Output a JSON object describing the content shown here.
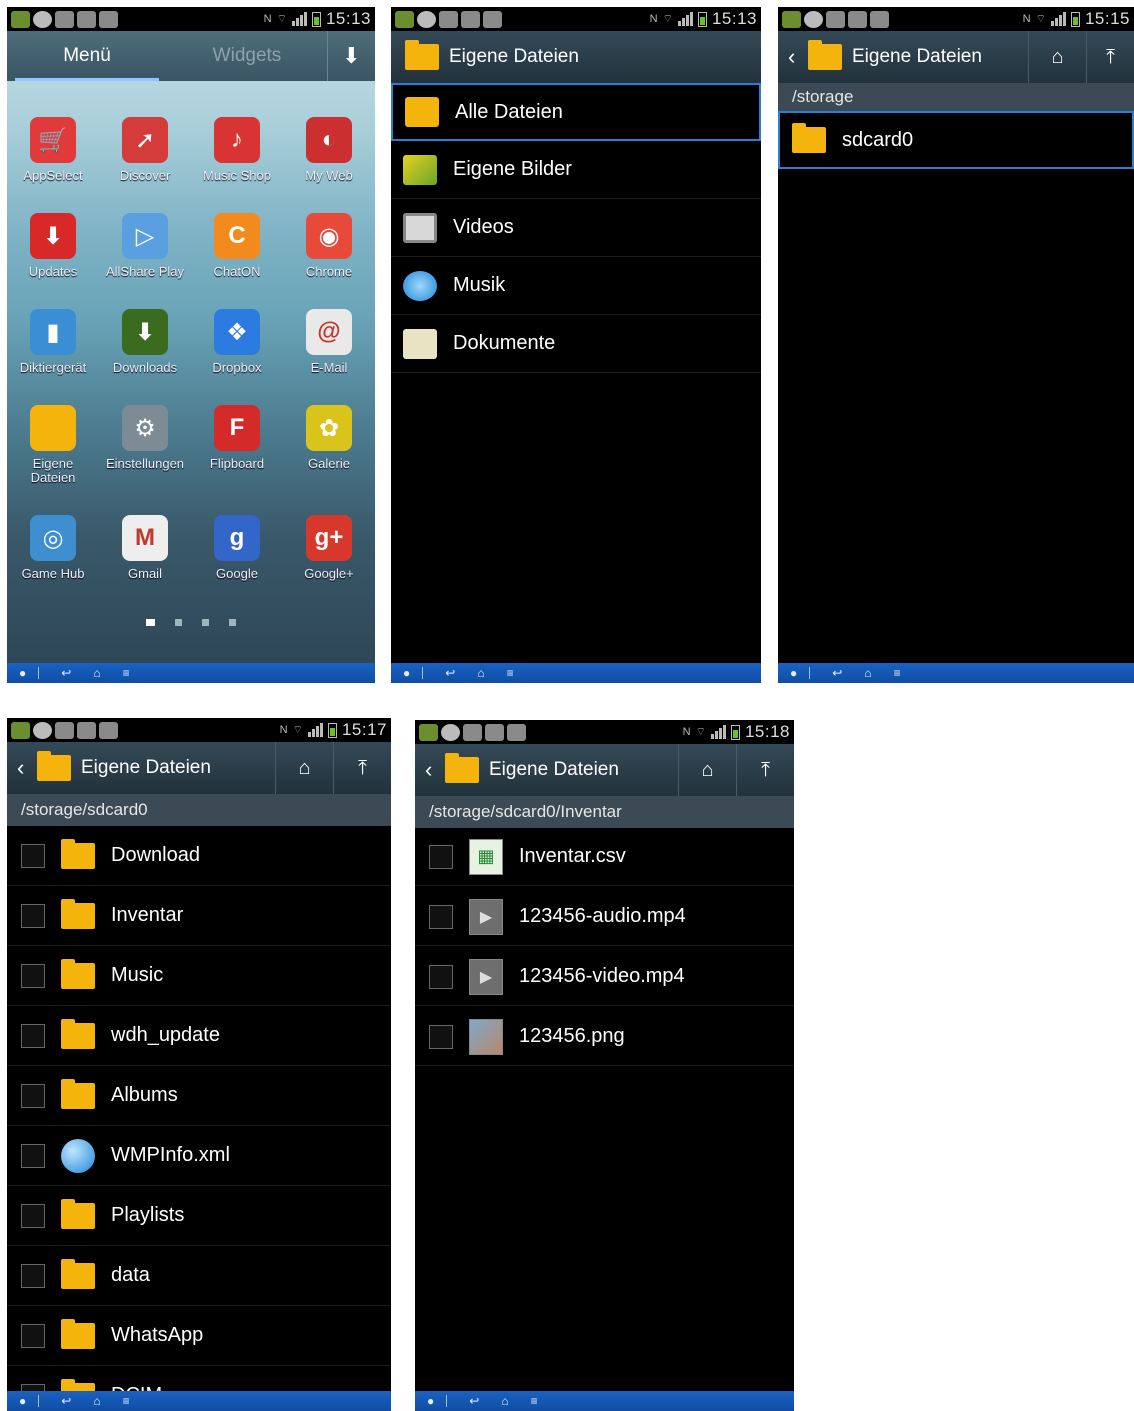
{
  "status": {
    "p1_clock": "15:13",
    "p2_clock": "15:13",
    "p3_clock": "15:15",
    "p4_clock": "15:17",
    "p5_clock": "15:18"
  },
  "home": {
    "tab_menu": "Menü",
    "tab_widgets": "Widgets",
    "apps": [
      {
        "label": "AppSelect",
        "color": "#e03a3a",
        "glyph": "🛒"
      },
      {
        "label": "Discover",
        "color": "#d43b3b",
        "glyph": "➚"
      },
      {
        "label": "Music Shop",
        "color": "#d93434",
        "glyph": "♪"
      },
      {
        "label": "My Web",
        "color": "#cc2f2f",
        "glyph": "◐"
      },
      {
        "label": "Updates",
        "color": "#d82828",
        "glyph": "⬇"
      },
      {
        "label": "AllShare Play",
        "color": "#5aa0e0",
        "glyph": "▷"
      },
      {
        "label": "ChatON",
        "color": "#f28a1e",
        "glyph": "C"
      },
      {
        "label": "Chrome",
        "color": "#e84a3a",
        "glyph": "◉"
      },
      {
        "label": "Diktiergerät",
        "color": "#3a8fd4",
        "glyph": "▮"
      },
      {
        "label": "Downloads",
        "color": "#3a6b1e",
        "glyph": "⬇"
      },
      {
        "label": "Dropbox",
        "color": "#2b7be0",
        "glyph": "❖"
      },
      {
        "label": "E-Mail",
        "color": "#e9e9e9",
        "glyph": "@"
      },
      {
        "label": "Eigene Dateien",
        "color": "#f5b40c",
        "glyph": ""
      },
      {
        "label": "Einstellungen",
        "color": "#7d8b95",
        "glyph": "⚙"
      },
      {
        "label": "Flipboard",
        "color": "#d42a2a",
        "glyph": "F"
      },
      {
        "label": "Galerie",
        "color": "#d9c41c",
        "glyph": "✿"
      },
      {
        "label": "Game Hub",
        "color": "#3d8fd0",
        "glyph": "◎"
      },
      {
        "label": "Gmail",
        "color": "#eeeeee",
        "glyph": "M"
      },
      {
        "label": "Google",
        "color": "#3465c8",
        "glyph": "g"
      },
      {
        "label": "Google+",
        "color": "#d6392b",
        "glyph": "g+"
      }
    ]
  },
  "fm": {
    "title": "Eigene Dateien",
    "categories": [
      "Alle Dateien",
      "Eigene Bilder",
      "Videos",
      "Musik",
      "Dokumente"
    ],
    "path_storage": "/storage",
    "storage_items": [
      "sdcard0"
    ],
    "path_sdcard": "/storage/sdcard0",
    "sdcard_items": [
      "Download",
      "Inventar",
      "Music",
      "wdh_update",
      "Albums",
      "WMPInfo.xml",
      "Playlists",
      "data",
      "WhatsApp",
      "DCIM"
    ],
    "path_inventar": "/storage/sdcard0/Inventar",
    "inventar_items": [
      "Inventar.csv",
      "123456-audio.mp4",
      "123456-video.mp4",
      "123456.png"
    ]
  },
  "colors": {
    "accent": "#2a7fd5",
    "navbar": "#1a62c4",
    "folder": "#f5b40c"
  }
}
